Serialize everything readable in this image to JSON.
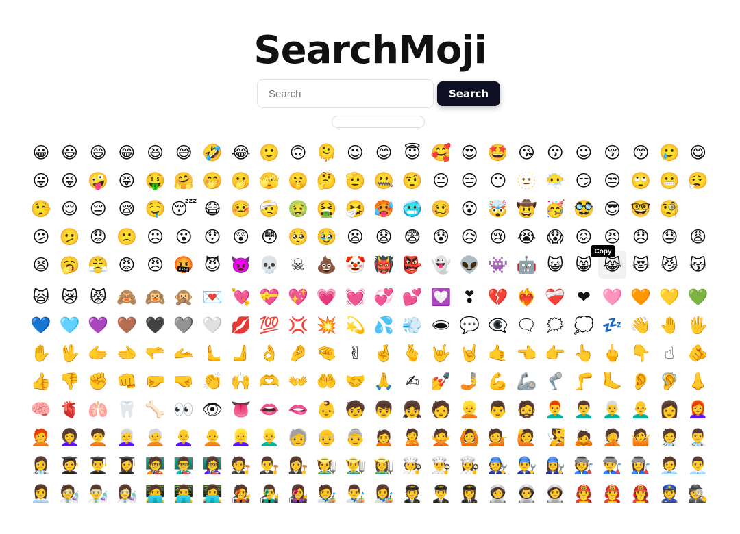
{
  "app": {
    "title": "SearchMoji"
  },
  "search": {
    "placeholder": "Search",
    "button_label": "Search"
  },
  "tooltip": {
    "label": "Copy"
  },
  "emoji_rows": [
    [
      "😀",
      "😃",
      "😄",
      "😁",
      "😆",
      "😅",
      "🤣",
      "😂",
      "🙂",
      "🙃",
      "🫠",
      "😉",
      "😊",
      "😇",
      "🥰",
      "😍",
      "🤩",
      "😘",
      "😗",
      "☺",
      "😚",
      "😙",
      "🥲",
      "😋"
    ],
    [
      "😛",
      "😜",
      "🤪",
      "😝",
      "🤑",
      "🤗",
      "🤭",
      "🫢",
      "🫣",
      "🤫",
      "🤔",
      "🫡",
      "🤐",
      "🤨",
      "😐",
      "😑",
      "😶",
      "🫥",
      "😶‍🌫️",
      "😏",
      "😒",
      "🙄",
      "😬",
      "😮‍💨"
    ],
    [
      "🤥",
      "😌",
      "😔",
      "😪",
      "🤤",
      "😴",
      "😷",
      "🤒",
      "🤕",
      "🤢",
      "🤮",
      "🤧",
      "🥵",
      "🥶",
      "🥴",
      "😵",
      "🤯",
      "🤠",
      "🥳",
      "🥸",
      "😎",
      "🤓",
      "🧐"
    ],
    [
      "😕",
      "🫤",
      "😟",
      "🙁",
      "☹",
      "😮",
      "😯",
      "😲",
      "😳",
      "🥺",
      "🥹",
      "😦",
      "😧",
      "😨",
      "😰",
      "😥",
      "😢",
      "😭",
      "😱",
      "😖",
      "😣",
      "😞",
      "😓",
      "😩"
    ],
    [
      "😫",
      "🥱",
      "😤",
      "😡",
      "😠",
      "🤬",
      "😈",
      "👿",
      "💀",
      "☠",
      "💩",
      "🤡",
      "👹",
      "👺",
      "👻",
      "👽",
      "👾",
      "🤖",
      "😺",
      "😸",
      "😹",
      "😻",
      "😼",
      "😽"
    ],
    [
      "🙀",
      "😿",
      "😾",
      "🙈",
      "🙉",
      "🙊",
      "💌",
      "💘",
      "💝",
      "💖",
      "💗",
      "💓",
      "💞",
      "💕",
      "💟",
      "❣",
      "💔",
      "❤‍🔥",
      "❤‍🩹",
      "❤",
      "🩷",
      "🧡",
      "💛",
      "💚"
    ],
    [
      "💙",
      "🩵",
      "💜",
      "🤎",
      "🖤",
      "🩶",
      "🤍",
      "💋",
      "💯",
      "💢",
      "💥",
      "💫",
      "💦",
      "💨",
      "🕳",
      "💬",
      "👁‍🗨",
      "🗨",
      "🗯",
      "💭",
      "💤",
      "👋",
      "🤚",
      "🖐"
    ],
    [
      "✋",
      "🖖",
      "🫱",
      "🫲",
      "🫳",
      "🫴",
      "🫷",
      "🫸",
      "👌",
      "🤌",
      "🤏",
      "✌",
      "🤞",
      "🫰",
      "🤟",
      "🤘",
      "🤙",
      "👈",
      "👉",
      "👆",
      "🖕",
      "👇",
      "☝",
      "🫵"
    ],
    [
      "👍",
      "👎",
      "✊",
      "👊",
      "🤛",
      "🤜",
      "👏",
      "🙌",
      "🫶",
      "👐",
      "🤲",
      "🤝",
      "🙏",
      "✍",
      "💅",
      "🤳",
      "💪",
      "🦾",
      "🦿",
      "🦵",
      "🦶",
      "👂",
      "🦻",
      "👃"
    ],
    [
      "🧠",
      "🫀",
      "🫁",
      "🦷",
      "🦴",
      "👀",
      "👁",
      "👅",
      "👄",
      "🫦",
      "👶",
      "🧒",
      "👦",
      "👧",
      "🧑",
      "👱",
      "👨",
      "🧔",
      "👨‍🦰",
      "👨‍🦱",
      "👨‍🦳",
      "👨‍🦲",
      "👩",
      "👩‍🦰"
    ],
    [
      "🧑‍🦰",
      "👩‍🦱",
      "🧑‍🦱",
      "👩‍🦳",
      "🧑‍🦳",
      "👩‍🦲",
      "🧑‍🦲",
      "👱‍♀️",
      "👱‍♂️",
      "🧓",
      "👴",
      "👵",
      "🙍",
      "🙎",
      "🙅",
      "🙆",
      "💁",
      "🙋",
      "🧏",
      "🙇",
      "🤦",
      "🤷",
      "🧑‍⚕️",
      "👨‍⚕️"
    ],
    [
      "👩‍⚕️",
      "🧑‍🎓",
      "👨‍🎓",
      "👩‍🎓",
      "🧑‍🏫",
      "👨‍🏫",
      "👩‍🏫",
      "🧑‍⚖️",
      "👨‍⚖️",
      "👩‍⚖️",
      "🧑‍🌾",
      "👨‍🌾",
      "👩‍🌾",
      "🧑‍🍳",
      "👨‍🍳",
      "👩‍🍳",
      "🧑‍🔧",
      "👨‍🔧",
      "👩‍🔧",
      "🧑‍🏭",
      "👨‍🏭",
      "👩‍🏭",
      "🧑‍💼",
      "👨‍💼"
    ],
    [
      "👩‍💼",
      "🧑‍🔬",
      "👨‍🔬",
      "👩‍🔬",
      "🧑‍💻",
      "👨‍💻",
      "👩‍💻",
      "🧑‍🎤",
      "👨‍🎤",
      "👩‍🎤",
      "🧑‍🎨",
      "👨‍🎨",
      "👩‍🎨",
      "🧑‍✈️",
      "👨‍✈️",
      "👩‍✈️",
      "🧑‍🚀",
      "👨‍🚀",
      "👩‍🚀",
      "🧑‍🚒",
      "👨‍🚒",
      "👩‍🚒",
      "👮",
      "🕵"
    ]
  ]
}
